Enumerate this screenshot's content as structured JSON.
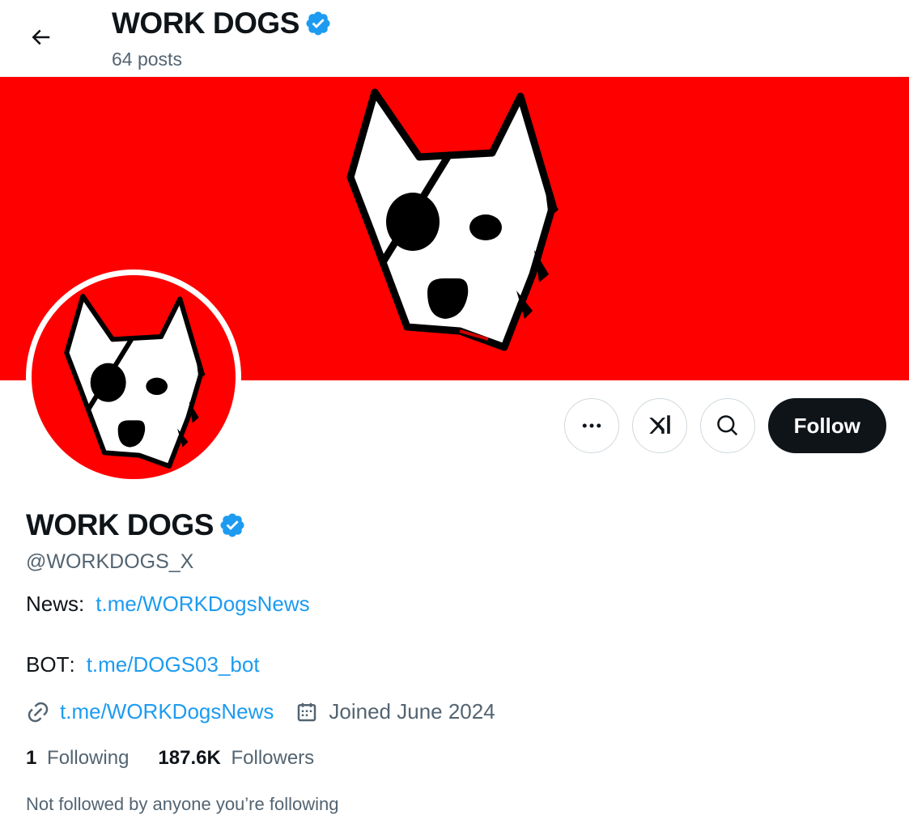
{
  "header": {
    "title": "WORK DOGS",
    "posts": "64 posts",
    "back_icon": "arrow-left-icon",
    "verified_icon": "verified-badge-icon"
  },
  "colors": {
    "banner_bg": "#ff0000",
    "verified_blue": "#1d9bf0",
    "link_blue": "#1d9bf0",
    "follow_button_bg": "#0f1419",
    "muted_text": "#536471"
  },
  "actions": {
    "more_icon": "more-dots-icon",
    "grok_icon": "grok-icon",
    "search_icon": "search-icon",
    "follow_label": "Follow"
  },
  "profile": {
    "name": "WORK DOGS",
    "handle": "@WORKDOGS_X",
    "bio": [
      {
        "label": "News",
        "separator": ":",
        "link": "t.me/WORKDogsNews"
      },
      {
        "label": "BOT",
        "separator": ":",
        "link": "t.me/DOGS03_bot"
      }
    ],
    "website": "t.me/WORKDogsNews",
    "joined": "Joined June 2024",
    "following_count": "1",
    "following_label": "Following",
    "followers_count": "187.6K",
    "followers_label": "Followers",
    "not_followed": "Not followed by anyone you’re following"
  }
}
